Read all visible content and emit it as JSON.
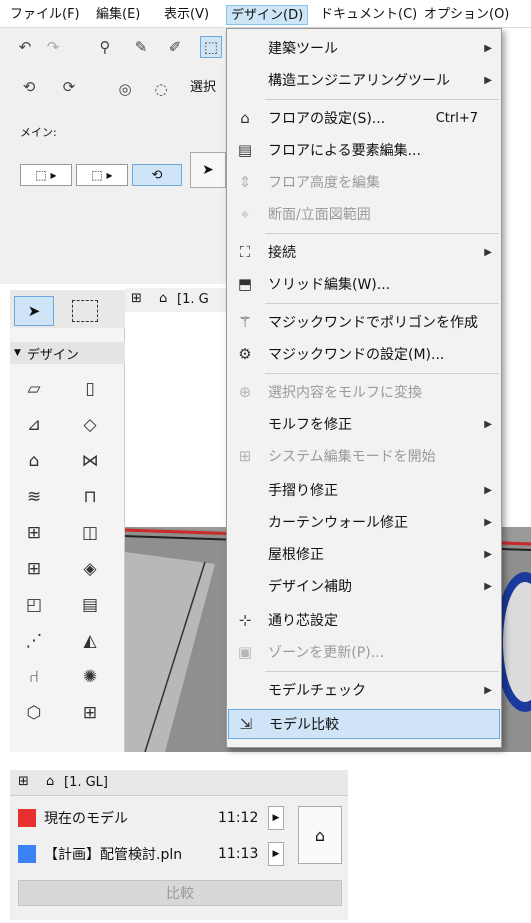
{
  "menubar": {
    "items": [
      "ファイル(F)",
      "編集(E)",
      "表示(V)",
      "デザイン(D)",
      "ドキュメント(C)",
      "オプション(O)"
    ]
  },
  "toolbar": {
    "selection_label": "選択",
    "main_label": "メイン:"
  },
  "tabs": {
    "floor_tab": "[1. G"
  },
  "palette": {
    "section_label": "デザイン"
  },
  "design_menu": {
    "items": [
      {
        "label": "建築ツール",
        "submenu": true,
        "icon": "none"
      },
      {
        "label": "構造エンジニアリングツール",
        "submenu": true,
        "icon": "none"
      },
      {
        "label": "フロアの設定(S)...",
        "shortcut": "Ctrl+7",
        "icon": "floor-settings-icon"
      },
      {
        "label": "フロアによる要素編集...",
        "icon": "floor-edit-icon"
      },
      {
        "label": "フロア高度を編集",
        "disabled": true,
        "icon": "floor-height-icon"
      },
      {
        "label": "断面/立面図範囲",
        "disabled": true,
        "icon": "section-range-icon"
      },
      {
        "label": "接続",
        "submenu": true,
        "icon": "connect-icon"
      },
      {
        "label": "ソリッド編集(W)...",
        "icon": "solid-edit-icon"
      },
      {
        "label": "マジックワンドでポリゴンを作成",
        "icon": "magic-wand-icon"
      },
      {
        "label": "マジックワンドの設定(M)...",
        "icon": "magic-wand-settings-icon"
      },
      {
        "label": "選択内容をモルフに変換",
        "disabled": true,
        "icon": "morph-convert-icon"
      },
      {
        "label": "モルフを修正",
        "submenu": true,
        "icon": "none"
      },
      {
        "label": "システム編集モードを開始",
        "disabled": true,
        "icon": "system-edit-icon"
      },
      {
        "label": "手摺り修正",
        "submenu": true,
        "icon": "none"
      },
      {
        "label": "カーテンウォール修正",
        "submenu": true,
        "icon": "none"
      },
      {
        "label": "屋根修正",
        "submenu": true,
        "icon": "none"
      },
      {
        "label": "デザイン補助",
        "submenu": true,
        "icon": "none"
      },
      {
        "label": "通り芯設定",
        "icon": "grid-settings-icon"
      },
      {
        "label": "ゾーンを更新(P)...",
        "disabled": true,
        "icon": "zone-update-icon"
      },
      {
        "label": "モデルチェック",
        "submenu": true,
        "icon": "none"
      },
      {
        "label": "モデル比較",
        "selected": true,
        "icon": "model-compare-icon"
      }
    ]
  },
  "compare_panel": {
    "tab_label": "[1. GL]",
    "rows": [
      {
        "name": "現在のモデル",
        "time": "11:12",
        "color": "#e83030"
      },
      {
        "name": "【計画】配管検討.pln",
        "time": "11:13",
        "color": "#3b82f6"
      }
    ],
    "compare_button": "比較"
  }
}
